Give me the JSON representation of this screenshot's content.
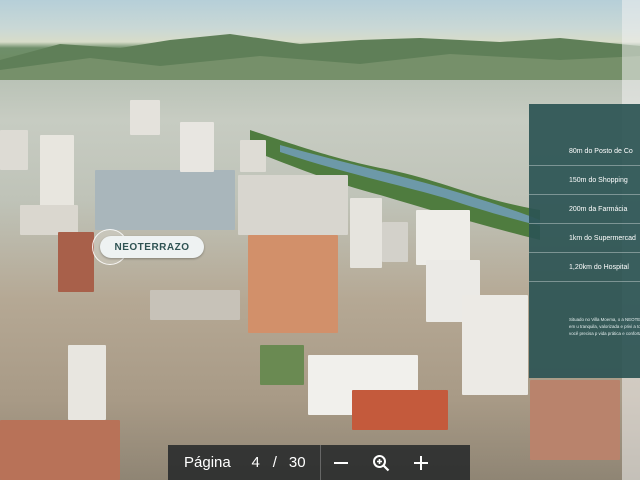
{
  "marker": {
    "label": "NEOTERRAZO"
  },
  "panel": {
    "items": [
      {
        "label": "80m do Posto de Co"
      },
      {
        "label": "150m do Shopping"
      },
      {
        "label": "200m da Farmácia"
      },
      {
        "label": "1km do Supermercad"
      },
      {
        "label": "1,20km do Hospital"
      }
    ],
    "note": "Situado no Villa Moema, o a NEOTERRAZO está em u tranquila, valorizada e privi a todos o que você precisa p vida prática e confortável."
  },
  "toolbar": {
    "page_label": "Página",
    "current_page": "4",
    "separator": "/",
    "total_pages": "30",
    "zoom_out_icon": "minus-icon",
    "zoom_icon": "zoom-in-magnifier-icon",
    "zoom_in_icon": "plus-icon"
  },
  "colors": {
    "panel_bg": "#2b5454",
    "toolbar_bg": "#1e2224",
    "marker_text": "#2f5353"
  }
}
